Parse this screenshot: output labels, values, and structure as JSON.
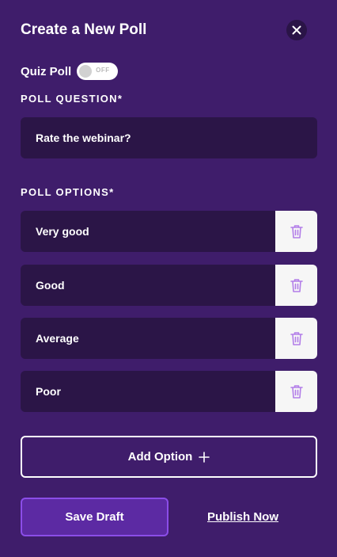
{
  "header": {
    "title": "Create a New Poll",
    "close_icon": "close-icon"
  },
  "quiz": {
    "label": "Quiz Poll",
    "toggle_state": "OFF"
  },
  "question": {
    "label": "POLL QUESTION*",
    "value": "Rate the webinar?"
  },
  "options": {
    "label": "POLL OPTIONS*",
    "items": [
      {
        "value": "Very good",
        "delete_icon": "trash-icon"
      },
      {
        "value": "Good",
        "delete_icon": "trash-icon"
      },
      {
        "value": "Average",
        "delete_icon": "trash-icon"
      },
      {
        "value": "Poor",
        "delete_icon": "trash-icon"
      }
    ]
  },
  "actions": {
    "add_option": "Add Option",
    "add_icon": "plus-icon",
    "save_draft": "Save Draft",
    "publish_now": "Publish Now"
  },
  "colors": {
    "background": "#3f1d6b",
    "field": "#2b1547",
    "primary": "#5c2aa3",
    "trash": "#b27de8"
  }
}
